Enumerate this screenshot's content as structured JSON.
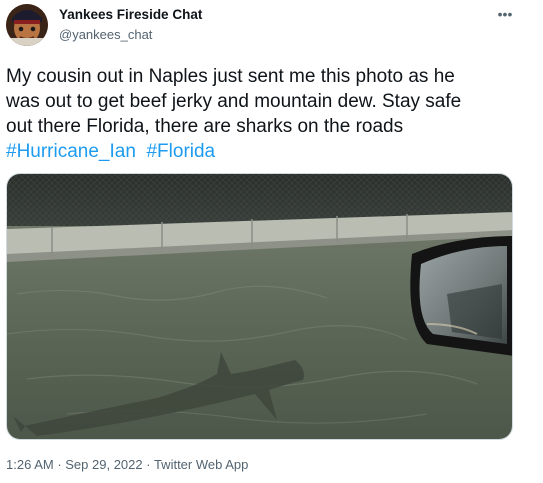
{
  "author": {
    "name": "Yankees Fireside Chat",
    "handle": "@yankees_chat"
  },
  "more_icon": "more-options-icon",
  "tweet": {
    "line1": "My cousin out in Naples just sent me this photo as he",
    "line2": "was out to get beef jerky and mountain dew. Stay safe",
    "line3": "out there Florida, there are sharks on the roads",
    "hashtags": [
      "#Hurricane_Ian",
      "#Florida"
    ]
  },
  "media": {
    "type": "photo"
  },
  "meta": {
    "time": "1:26 AM",
    "separator": " · ",
    "date": "Sep 29, 2022",
    "source": "Twitter Web App"
  },
  "colors": {
    "hashtag": "#1d9bf0",
    "secondary_text": "#536471",
    "primary_text": "#0f1419"
  }
}
